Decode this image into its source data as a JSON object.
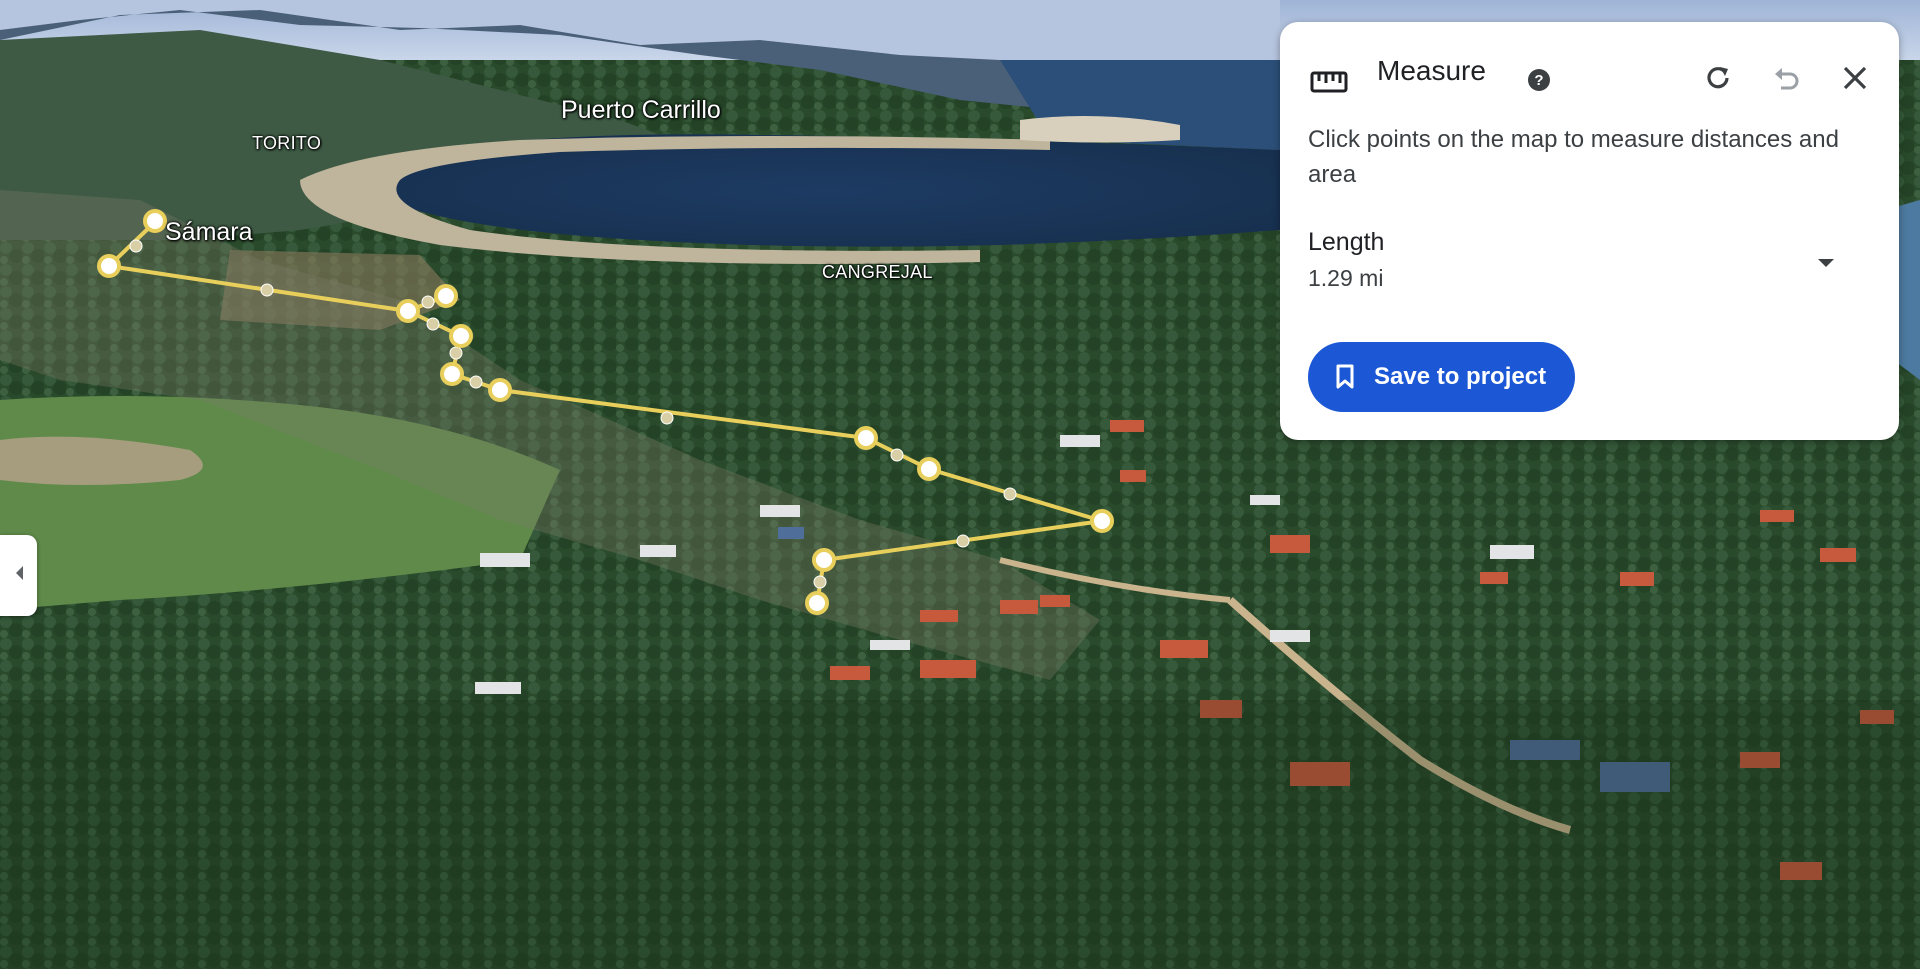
{
  "map": {
    "places": [
      {
        "name": "Puerto Carrillo"
      },
      {
        "name": "TORITO"
      },
      {
        "name": "Sámara"
      },
      {
        "name": "CANGREJAL"
      }
    ]
  },
  "measure": {
    "title": "Measure",
    "description": "Click points on the map to measure distances and area",
    "metric_label": "Length",
    "metric_value": "1.29 mi",
    "save_label": "Save to project",
    "icons": {
      "ruler": "ruler-icon",
      "help": "help-icon",
      "redo": "redo-icon",
      "undo": "undo-icon",
      "close": "close-icon",
      "dropdown": "dropdown-arrow-icon",
      "bookmark": "bookmark-icon"
    }
  },
  "side_toggle": {
    "icon": "chevron-left-icon"
  },
  "colors": {
    "measure_line": "#e8cf5c",
    "button_blue": "#1c57d6"
  }
}
